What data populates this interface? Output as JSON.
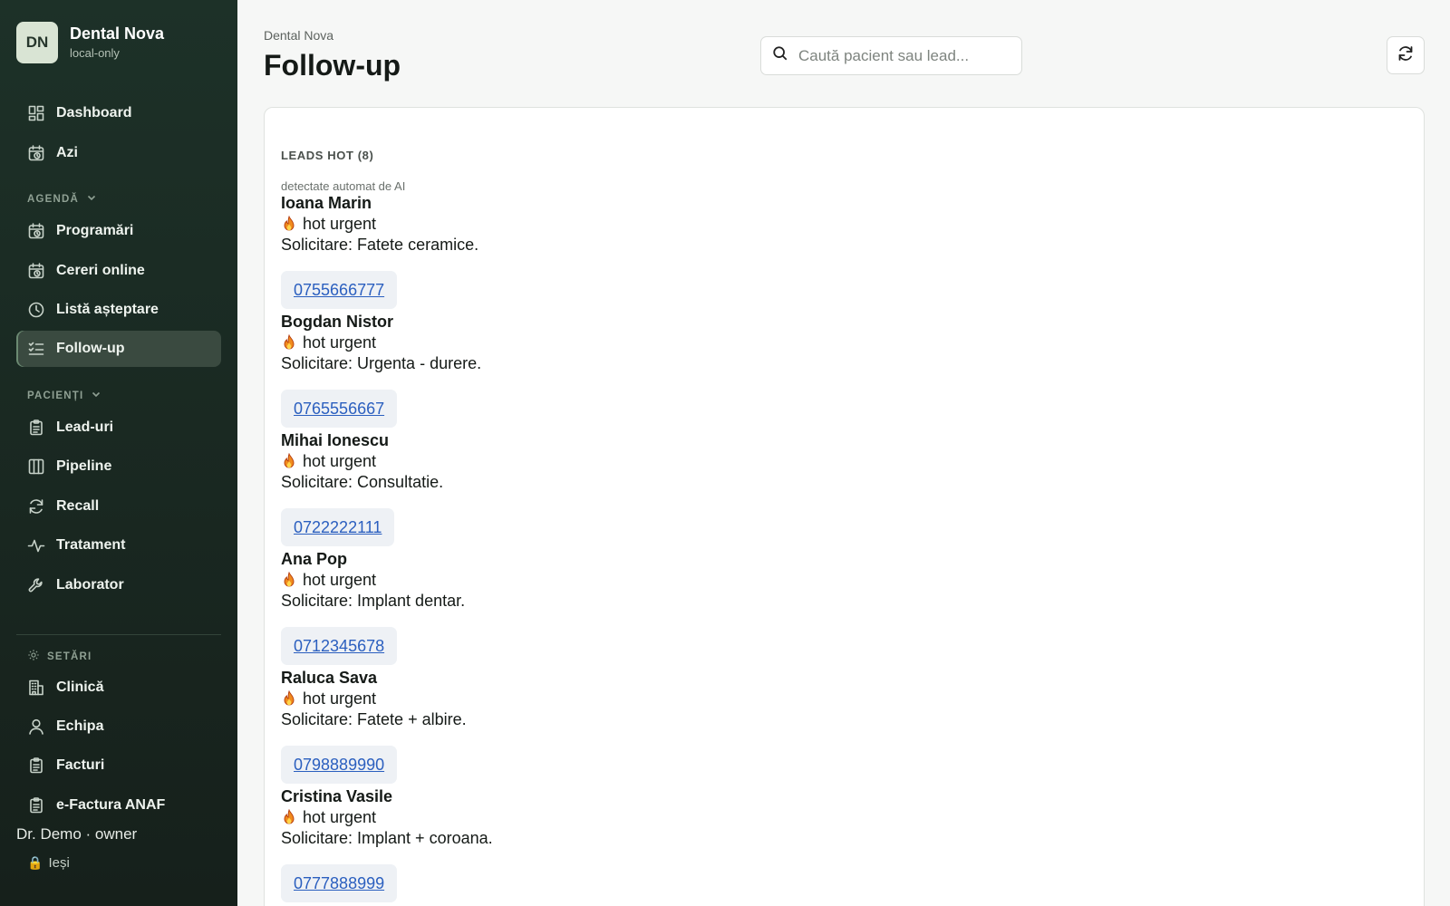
{
  "brand": {
    "initials": "DN",
    "name": "Dental Nova",
    "subtitle": "local-only"
  },
  "nav": {
    "dashboard": "Dashboard",
    "today": "Azi",
    "agenda_label": "AGENDĂ",
    "appointments": "Programări",
    "online_requests": "Cereri online",
    "waitlist": "Listă așteptare",
    "followup": "Follow-up",
    "patients_label": "PACIENȚI",
    "leads": "Lead-uri",
    "pipeline": "Pipeline",
    "recall": "Recall",
    "treatment": "Tratament",
    "lab": "Laborator",
    "settings_label": "SETĂRI",
    "clinic": "Clinică",
    "team": "Echipa",
    "invoices": "Facturi",
    "einvoice": "e-Factura ANAF"
  },
  "user": {
    "line": "Dr. Demo · owner",
    "logout": "Ieși"
  },
  "header": {
    "breadcrumb": "Dental Nova",
    "title": "Follow-up",
    "search_placeholder": "Caută pacient sau lead..."
  },
  "card": {
    "title": "LEADS HOT (8)",
    "subtitle": "detectate automat de AI",
    "leads": [
      {
        "name": "Ioana Marin",
        "tag": "hot urgent",
        "request": "Solicitare: Fatete ceramice.",
        "phone": "0755666777"
      },
      {
        "name": "Bogdan Nistor",
        "tag": "hot urgent",
        "request": "Solicitare: Urgenta - durere.",
        "phone": "0765556667"
      },
      {
        "name": "Mihai Ionescu",
        "tag": "hot urgent",
        "request": "Solicitare: Consultatie.",
        "phone": "0722222111"
      },
      {
        "name": "Ana Pop",
        "tag": "hot urgent",
        "request": "Solicitare: Implant dentar.",
        "phone": "0712345678"
      },
      {
        "name": "Raluca Sava",
        "tag": "hot urgent",
        "request": "Solicitare: Fatete + albire.",
        "phone": "0798889990"
      },
      {
        "name": "Cristina Vasile",
        "tag": "hot urgent",
        "request": "Solicitare: Implant + coroana.",
        "phone": "0777888999"
      }
    ]
  }
}
